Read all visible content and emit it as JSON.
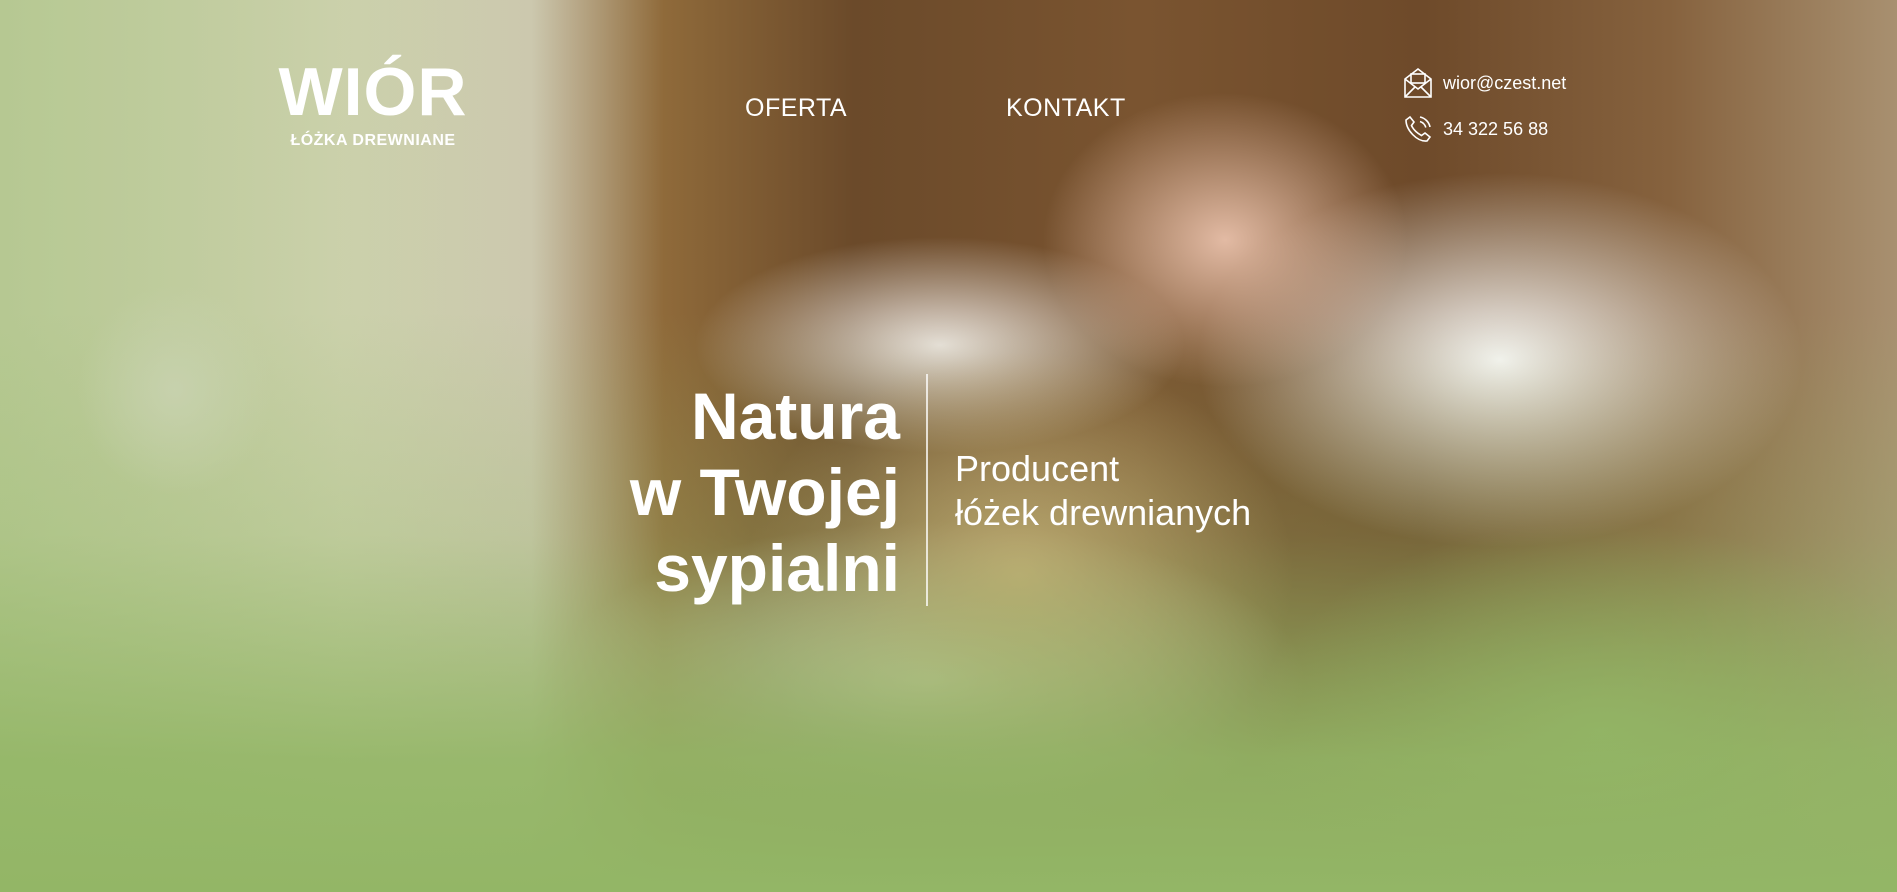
{
  "logo": {
    "title": "WIÓR",
    "subtitle": "ŁÓŻKA DREWNIANE"
  },
  "nav": {
    "items": [
      {
        "label": "OFERTA"
      },
      {
        "label": "KONTAKT"
      }
    ]
  },
  "contact": {
    "email": "wior@czest.net",
    "email_icon": "envelope-icon",
    "phone": "34 322 56 88",
    "phone_icon": "phone-icon"
  },
  "hero": {
    "headline": [
      "Natura",
      "w Twojej",
      "sypialni"
    ],
    "tagline": [
      "Producent",
      "łóżek drewnianych"
    ]
  },
  "colors": {
    "text": "#ffffff",
    "overlay_green": "#93b666"
  }
}
